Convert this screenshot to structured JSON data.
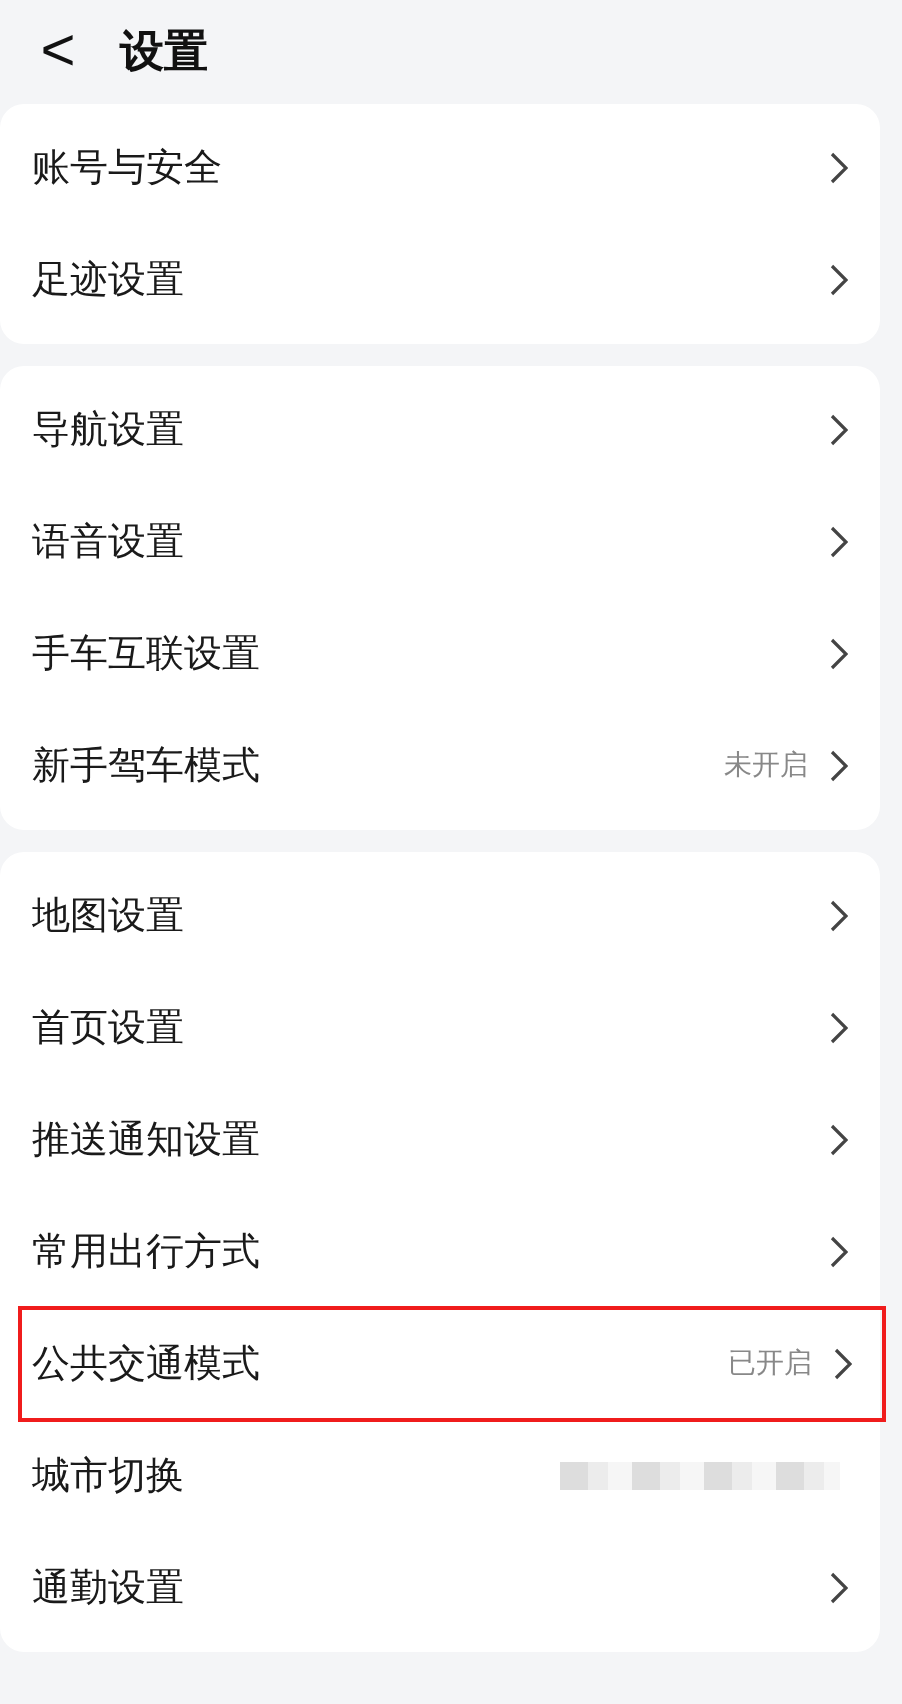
{
  "header": {
    "back": "<",
    "title": "设置"
  },
  "groups": [
    {
      "items": [
        {
          "label": "账号与安全",
          "chevron": true
        },
        {
          "label": "足迹设置",
          "chevron": true
        }
      ]
    },
    {
      "items": [
        {
          "label": "导航设置",
          "chevron": true
        },
        {
          "label": "语音设置",
          "chevron": true
        },
        {
          "label": "手车互联设置",
          "chevron": true
        },
        {
          "label": "新手驾车模式",
          "value": "未开启",
          "chevron": true
        }
      ]
    },
    {
      "items": [
        {
          "label": "地图设置",
          "chevron": true
        },
        {
          "label": "首页设置",
          "chevron": true
        },
        {
          "label": "推送通知设置",
          "chevron": true
        },
        {
          "label": "常用出行方式",
          "chevron": true
        },
        {
          "label": "公共交通模式",
          "value": "已开启",
          "chevron": true,
          "highlighted": true
        },
        {
          "label": "城市切换",
          "redacted": true,
          "chevron": false
        },
        {
          "label": "通勤设置",
          "chevron": true
        }
      ]
    }
  ]
}
